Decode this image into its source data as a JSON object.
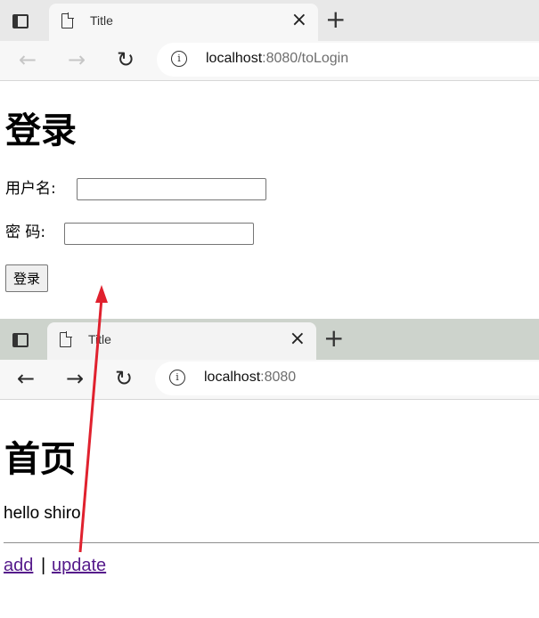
{
  "top_window": {
    "tab_title": "Title",
    "tab_close": "×",
    "new_tab": "+",
    "url_host": "localhost",
    "url_path": ":8080/toLogin",
    "heading": "登录",
    "username_label": "用户名:",
    "password_label": "密 码:",
    "username_value": "",
    "password_value": "",
    "submit_label": "登录"
  },
  "bottom_window": {
    "tab_title": "Title",
    "tab_close": "×",
    "new_tab": "+",
    "url_host": "localhost",
    "url_path": ":8080",
    "heading": "首页",
    "greeting": "hello shiro",
    "links": [
      {
        "label": "add"
      },
      {
        "label": "update"
      }
    ],
    "link_separator": "|"
  },
  "colors": {
    "annotation_arrow": "#e0212e",
    "link": "#551a8b",
    "tabstrip_top": "#e8e8e8",
    "tabstrip_bottom": "#cdd3cc"
  },
  "icons": [
    "sidebar-toggle-icon",
    "page-icon",
    "close-icon",
    "plus-icon",
    "back-icon",
    "forward-icon",
    "reload-icon",
    "info-icon"
  ]
}
